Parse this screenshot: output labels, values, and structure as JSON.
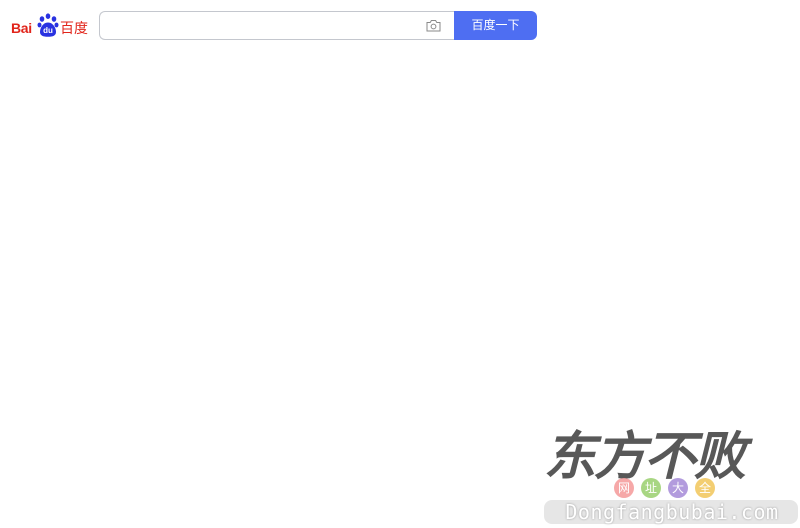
{
  "header": {
    "logo": {
      "text_left": "Bai",
      "paw_text": "du",
      "text_right": "百度",
      "color": "#e1251b",
      "paw_color": "#2932e1"
    },
    "search": {
      "value": "",
      "placeholder": "",
      "button_label": "百度一下",
      "button_color": "#4e6ef2"
    },
    "icons": {
      "camera": "camera-icon"
    }
  },
  "watermark": {
    "brand": "东方不败",
    "subtitle_chars": [
      "网",
      "址",
      "大",
      "全"
    ],
    "subtitle_colors": [
      "#f59a9a",
      "#9ad06e",
      "#a58ad8",
      "#f2c65a"
    ],
    "url": "Dongfangbubai.com"
  }
}
